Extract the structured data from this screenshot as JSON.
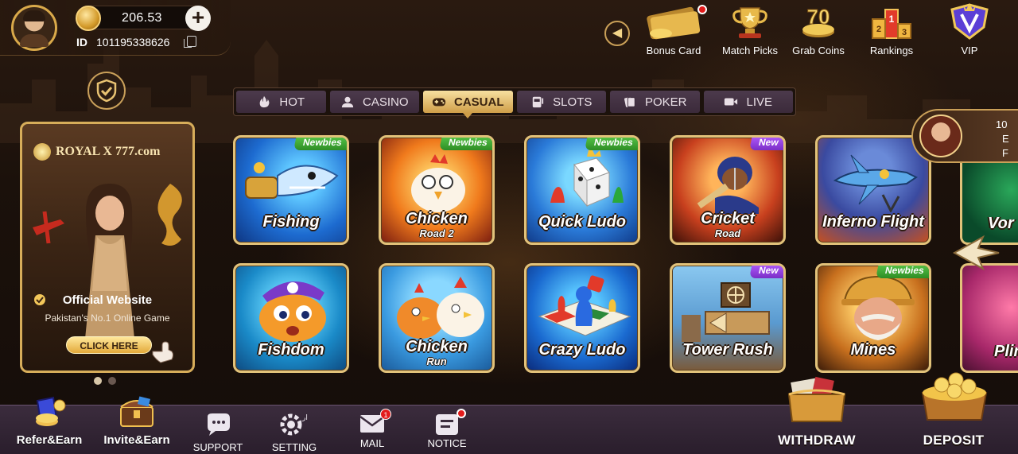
{
  "profile": {
    "balance": "206.53",
    "id_label": "ID",
    "id_value": "101195338626"
  },
  "top_nav": [
    {
      "label": "Bonus Card",
      "icon": "bonus-card-icon",
      "has_dot": true
    },
    {
      "label": "Match Picks",
      "icon": "trophy-icon",
      "has_dot": false
    },
    {
      "label": "Grab Coins",
      "icon": "grab-coins-icon",
      "has_dot": false
    },
    {
      "label": "Rankings",
      "icon": "rankings-podium-icon",
      "has_dot": false
    },
    {
      "label": "VIP",
      "icon": "vip-crest-icon",
      "has_dot": false
    }
  ],
  "tabs": [
    {
      "label": "HOT",
      "icon": "flame-icon",
      "active": false
    },
    {
      "label": "CASINO",
      "icon": "user-group-icon",
      "active": false
    },
    {
      "label": "CASUAL",
      "icon": "gamepad-icon",
      "active": true
    },
    {
      "label": "SLOTS",
      "icon": "slot-machine-icon",
      "active": false
    },
    {
      "label": "POKER",
      "icon": "cards-icon",
      "active": false
    },
    {
      "label": "LIVE",
      "icon": "video-icon",
      "active": false
    }
  ],
  "banner": {
    "logo": "ROYAL X 777.com",
    "official": "Official Website",
    "tagline": "Pakistan's No.1 Online Game",
    "cta": "CLICK HERE"
  },
  "games_row1": [
    {
      "name": "Fishing",
      "sub": "",
      "tag": "Newbies"
    },
    {
      "name": "Chicken",
      "sub": "Road 2",
      "tag": "Newbies"
    },
    {
      "name": "Quick Ludo",
      "sub": "",
      "tag": "Newbies"
    },
    {
      "name": "Cricket",
      "sub": "Road",
      "tag": "New"
    },
    {
      "name": "Inferno Flight",
      "sub": "",
      "tag": ""
    }
  ],
  "games_row2": [
    {
      "name": "Fishdom",
      "sub": "",
      "tag": ""
    },
    {
      "name": "Chicken",
      "sub": "Run",
      "tag": ""
    },
    {
      "name": "Crazy Ludo",
      "sub": "",
      "tag": ""
    },
    {
      "name": "Tower Rush",
      "sub": "",
      "tag": "New"
    },
    {
      "name": "Mines",
      "sub": "",
      "tag": "Newbies"
    }
  ],
  "partial_games": {
    "row1": "Vor",
    "row2": "Plin"
  },
  "promo": {
    "text_line1": "10",
    "text_line2": "E",
    "text_line3": "F"
  },
  "bottom_bar": {
    "refer": "Refer&Earn",
    "invite": "Invite&Earn",
    "support": "SUPPORT",
    "setting": "SETTING",
    "mail": "MAIL",
    "mail_badge": "1",
    "notice": "NOTICE",
    "withdraw": "WITHDRAW",
    "deposit": "DEPOSIT"
  },
  "colors": {
    "gold": "#e2c27a",
    "accent_red": "#e21b1b",
    "newbies_green": "#3fae33",
    "new_purple": "#9645e3"
  }
}
